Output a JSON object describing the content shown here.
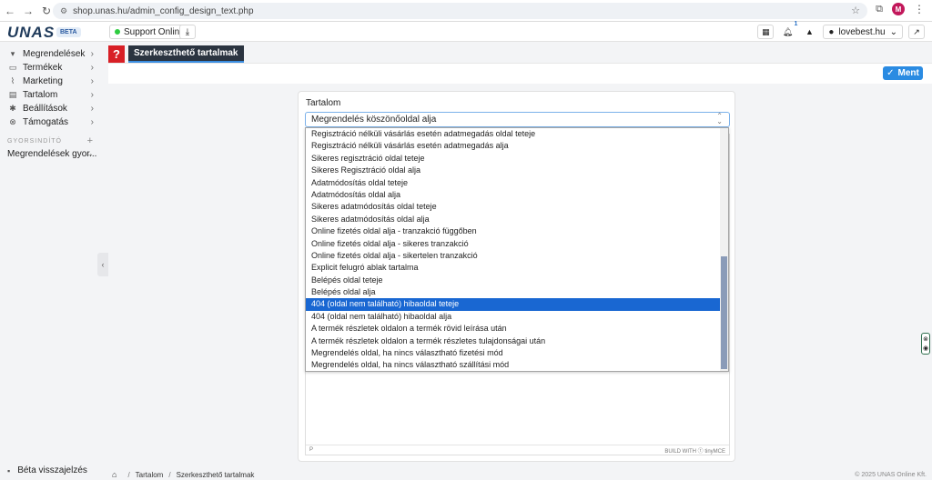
{
  "browser": {
    "url": "shop.unas.hu/admin_config_design_text.php",
    "profile_initial": "M"
  },
  "header": {
    "logo": "UNAS",
    "beta_badge": "BETA",
    "support_label": "Support Online",
    "notification_count": "1",
    "shop_name": "lovebest.hu"
  },
  "sidebar": {
    "items": [
      {
        "label": "Megrendelések",
        "icon": "cart-icon"
      },
      {
        "label": "Termékek",
        "icon": "box-icon"
      },
      {
        "label": "Marketing",
        "icon": "chart-icon"
      },
      {
        "label": "Tartalom",
        "icon": "document-icon"
      },
      {
        "label": "Beállítások",
        "icon": "gear-icon"
      },
      {
        "label": "Támogatás",
        "icon": "help-icon"
      }
    ],
    "section_label": "GYORSINDÍTÓ",
    "quick_item": "Megrendelések gyor...",
    "beta_feedback": "Béta visszajelzés"
  },
  "page": {
    "help_label": "?",
    "title": "Szerkeszthető tartalmak",
    "save_label": "Ment"
  },
  "form": {
    "label": "Tartalom",
    "selected_value": "Megrendelés köszönőoldal alja",
    "editor_path": "P",
    "editor_brand": "BUILD WITH ⓣ tinyMCE"
  },
  "dropdown": {
    "items": [
      "Regisztráció nélküli vásárlás esetén adatmegadás oldal teteje",
      "Regisztráció nélküli vásárlás esetén adatmegadás alja",
      "Sikeres regisztráció oldal teteje",
      "Sikeres Regisztráció oldal alja",
      "Adatmódosítás oldal teteje",
      "Adatmódosítás oldal alja",
      "Sikeres adatmódosítás oldal teteje",
      "Sikeres adatmódosítás oldal alja",
      "Online fizetés oldal alja - tranzakció függőben",
      "Online fizetés oldal alja - sikeres tranzakció",
      "Online fizetés oldal alja - sikertelen tranzakció",
      "Explicit felugró ablak tartalma",
      "Belépés oldal teteje",
      "Belépés oldal alja",
      "404 (oldal nem található) hibaoldal teteje",
      "404 (oldal nem található) hibaoldal alja",
      "A termék részletek oldalon a termék rövid leírása után",
      "A termék részletek oldalon a termék részletes tulajdonságai után",
      "Megrendelés oldal, ha nincs választható fizetési mód",
      "Megrendelés oldal, ha nincs választható szállítási mód"
    ],
    "selected_index": 14
  },
  "footer": {
    "breadcrumb": [
      "Tartalom",
      "Szerkeszthető tartalmak"
    ],
    "copyright": "© 2025 UNAS Online Kft."
  },
  "colors": {
    "accent": "#2a8be2",
    "help_red": "#d81f26",
    "selection": "#1967d2",
    "title_tab": "#2b3440"
  }
}
